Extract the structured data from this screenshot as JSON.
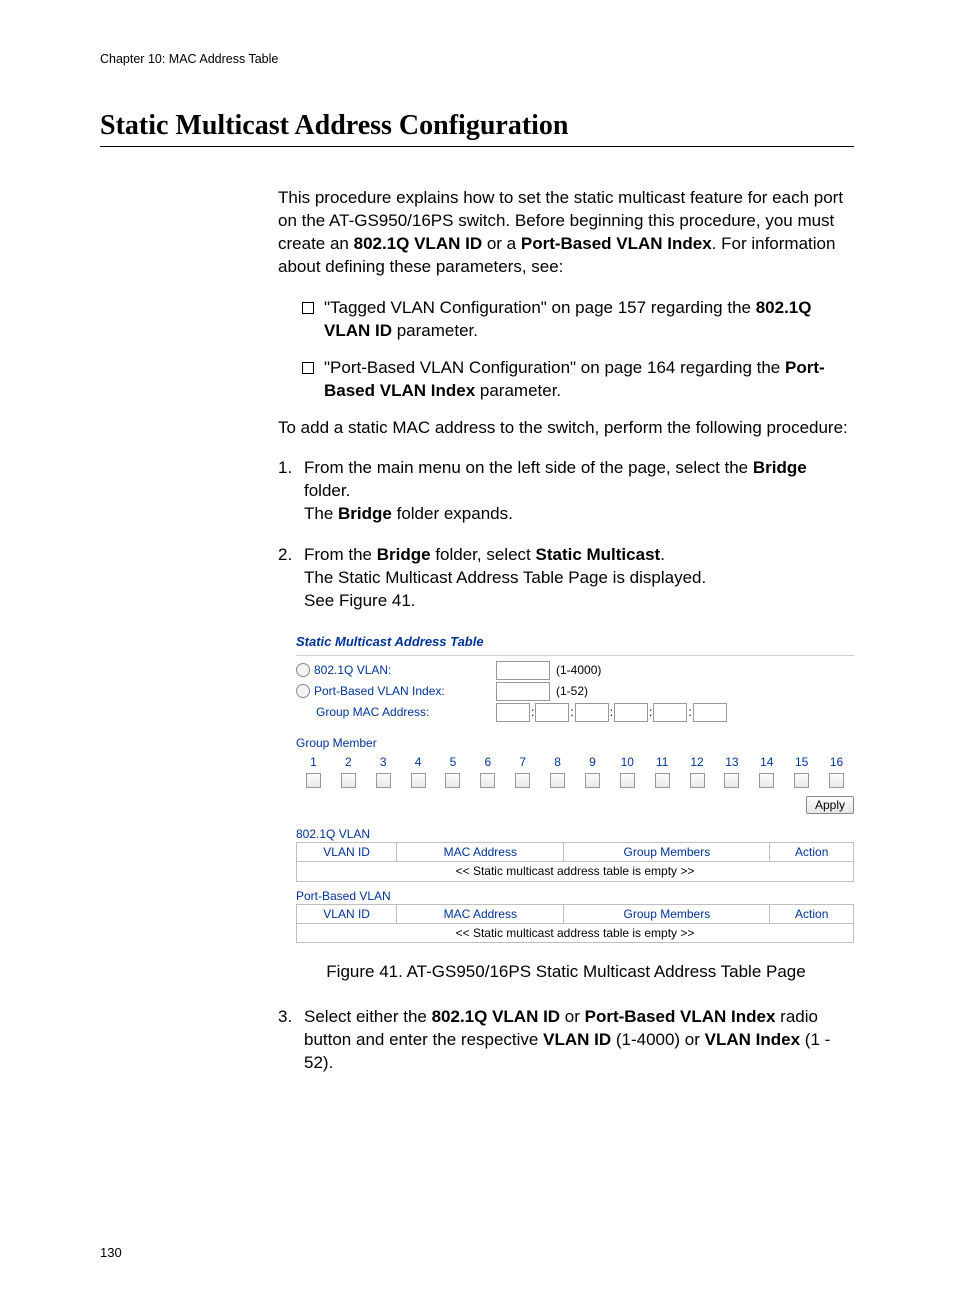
{
  "chapter": "Chapter 10: MAC Address Table",
  "heading": "Static Multicast Address Configuration",
  "intro": {
    "pre": "This procedure explains how to set the static multicast feature for each port on the AT-GS950/16PS switch. Before beginning this procedure, you must create an ",
    "b1": "802.1Q VLAN ID",
    "mid": " or a ",
    "b2": "Port-Based VLAN Index",
    "post": ". For information about defining these parameters, see:"
  },
  "bullets": {
    "a": {
      "pre": "\"Tagged VLAN Configuration\" on page 157 regarding the ",
      "b": "802.1Q VLAN ID",
      "post": " parameter."
    },
    "b": {
      "pre": "\"Port-Based VLAN Configuration\" on page 164 regarding the ",
      "b": "Port-Based VLAN Index",
      "post": " parameter."
    }
  },
  "lead2": "To add a static MAC address to the switch, perform the following procedure:",
  "steps": {
    "s1": {
      "num": "1.",
      "pre": "From the main menu on the left side of the page, select the ",
      "b1": "Bridge",
      "post1": " folder.",
      "line2a": "The ",
      "line2b": "Bridge",
      "line2c": " folder expands."
    },
    "s2": {
      "num": "2.",
      "pre": "From the ",
      "b1": "Bridge",
      "mid": " folder, select ",
      "b2": "Static Multicast",
      "post": ".",
      "line2": "The Static Multicast Address Table Page is displayed.",
      "line3": "See Figure 41."
    },
    "s3": {
      "num": "3.",
      "pre": "Select either the ",
      "b1": "802.1Q VLAN ID",
      "mid1": " or ",
      "b2": "Port-Based VLAN Index",
      "mid2": " radio button and enter the respective ",
      "b3": "VLAN ID",
      "mid3": " (1-4000) or ",
      "b4": "VLAN Index",
      "post": " (1 - 52)."
    }
  },
  "fig": {
    "title": "Static Multicast Address Table",
    "vlan8021q_label": "802.1Q VLAN:",
    "vlan8021q_range": "(1-4000)",
    "portvlan_label": "Port-Based VLAN Index:",
    "portvlan_range": "(1-52)",
    "mac_label": "Group MAC Address:",
    "group_member": "Group Member",
    "ports": [
      "1",
      "2",
      "3",
      "4",
      "5",
      "6",
      "7",
      "8",
      "9",
      "10",
      "11",
      "12",
      "13",
      "14",
      "15",
      "16"
    ],
    "apply": "Apply",
    "sect1": "802.1Q VLAN",
    "sect2": "Port-Based VLAN",
    "th_vlan": "VLAN ID",
    "th_mac": "MAC Address",
    "th_grp": "Group Members",
    "th_act": "Action",
    "empty": "<< Static multicast address table is empty >>",
    "caption": "Figure 41. AT-GS950/16PS Static Multicast Address Table Page"
  },
  "page_number": "130"
}
